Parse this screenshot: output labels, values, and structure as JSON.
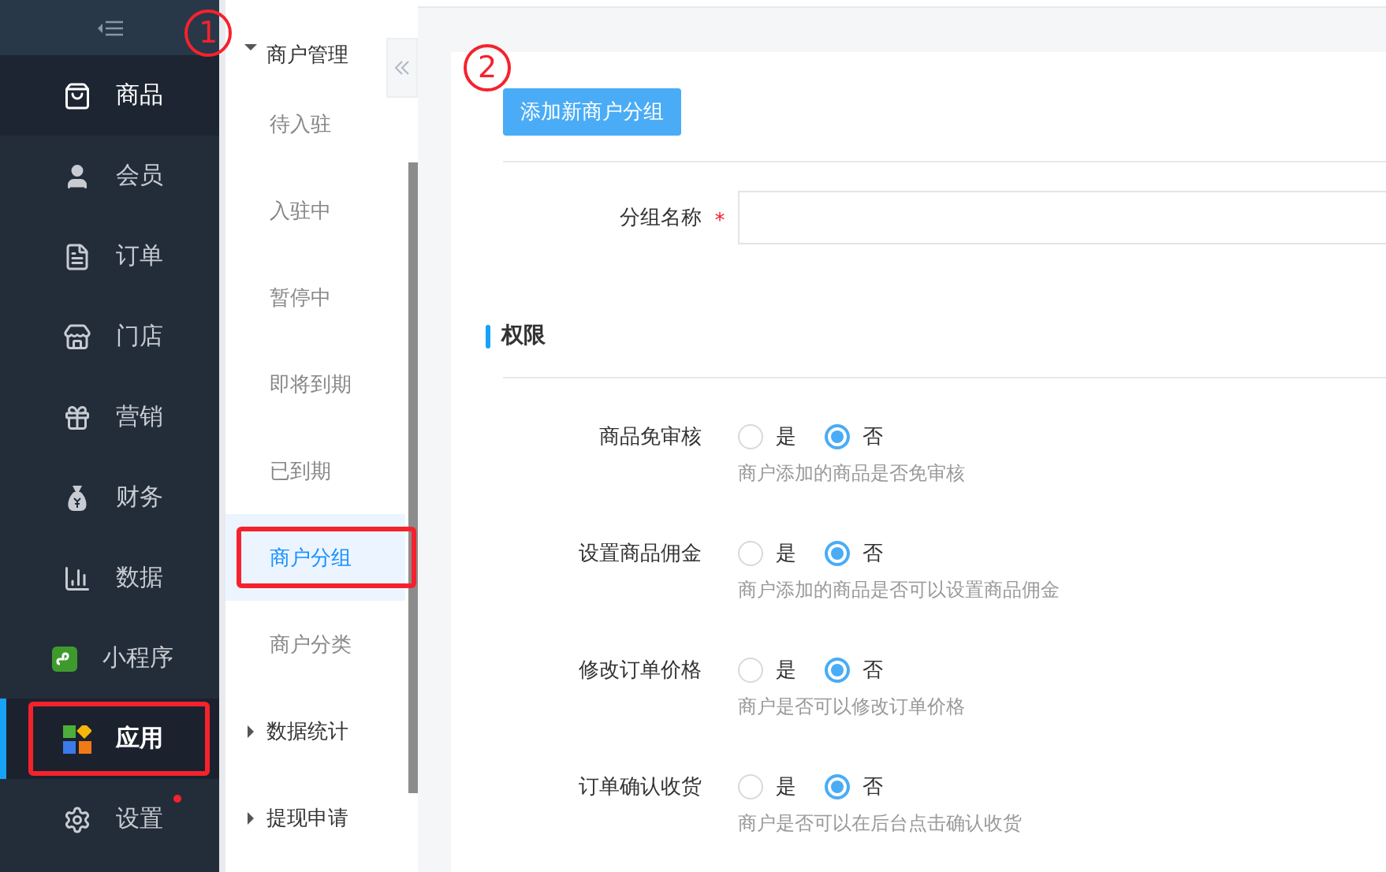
{
  "sidebar": {
    "items": [
      {
        "label": "商品",
        "selected": false,
        "hovered": true,
        "outlined": false,
        "badge": false
      },
      {
        "label": "会员",
        "selected": false,
        "hovered": false,
        "outlined": false,
        "badge": false
      },
      {
        "label": "订单",
        "selected": false,
        "hovered": false,
        "outlined": false,
        "badge": false
      },
      {
        "label": "门店",
        "selected": false,
        "hovered": false,
        "outlined": false,
        "badge": false
      },
      {
        "label": "营销",
        "selected": false,
        "hovered": false,
        "outlined": false,
        "badge": false
      },
      {
        "label": "财务",
        "selected": false,
        "hovered": false,
        "outlined": false,
        "badge": false
      },
      {
        "label": "数据",
        "selected": false,
        "hovered": false,
        "outlined": false,
        "badge": false
      },
      {
        "label": "小程序",
        "selected": false,
        "hovered": false,
        "outlined": false,
        "badge": false
      },
      {
        "label": "应用",
        "selected": true,
        "hovered": false,
        "outlined": true,
        "badge": false
      },
      {
        "label": "设置",
        "selected": false,
        "hovered": false,
        "outlined": false,
        "badge": true
      }
    ]
  },
  "submenu": {
    "groups": [
      {
        "label": "商户管理",
        "expanded": true,
        "children": [
          {
            "label": "待入驻",
            "selected": false,
            "outlined": false
          },
          {
            "label": "入驻中",
            "selected": false,
            "outlined": false
          },
          {
            "label": "暂停中",
            "selected": false,
            "outlined": false
          },
          {
            "label": "即将到期",
            "selected": false,
            "outlined": false
          },
          {
            "label": "已到期",
            "selected": false,
            "outlined": false
          },
          {
            "label": "商户分组",
            "selected": true,
            "outlined": true
          },
          {
            "label": "商户分类",
            "selected": false,
            "outlined": false
          }
        ]
      },
      {
        "label": "数据统计",
        "expanded": false
      },
      {
        "label": "提现申请",
        "expanded": false
      }
    ]
  },
  "annotations": [
    {
      "label": "1"
    },
    {
      "label": "2"
    }
  ],
  "add_button": "添加新商户分组",
  "group_name": {
    "label": "分组名称",
    "required_mark": "*"
  },
  "section_title": "权限",
  "permissions": [
    {
      "label": "商品免审核",
      "options": [
        {
          "label": "是",
          "selected": false
        },
        {
          "label": "否",
          "selected": true
        }
      ],
      "hint": "商户添加的商品是否免审核"
    },
    {
      "label": "设置商品佣金",
      "options": [
        {
          "label": "是",
          "selected": false
        },
        {
          "label": "否",
          "selected": true
        }
      ],
      "hint": "商户添加的商品是否可以设置商品佣金"
    },
    {
      "label": "修改订单价格",
      "options": [
        {
          "label": "是",
          "selected": false
        },
        {
          "label": "否",
          "selected": true
        }
      ],
      "hint": "商户是否可以修改订单价格"
    },
    {
      "label": "订单确认收货",
      "options": [
        {
          "label": "是",
          "selected": false
        },
        {
          "label": "否",
          "selected": true
        }
      ],
      "hint": "商户是否可以在后台点击确认收货"
    }
  ]
}
